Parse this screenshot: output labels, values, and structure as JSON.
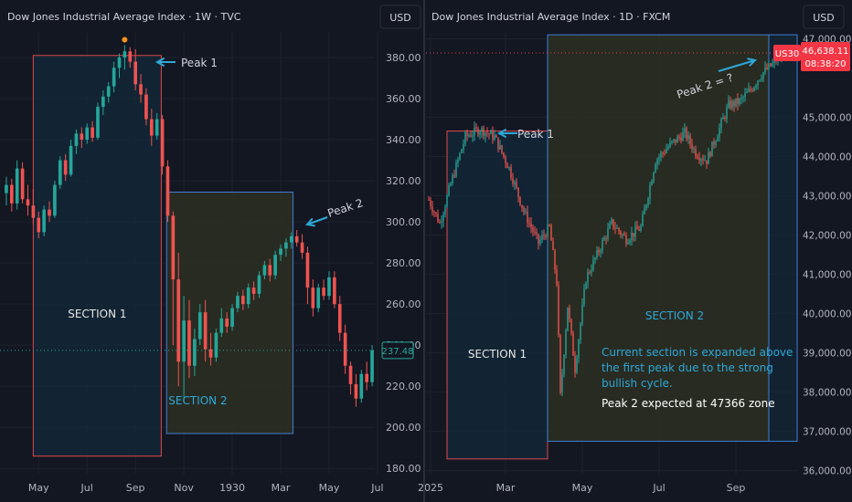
{
  "colors": {
    "background": "#131722",
    "grid": "#1e222d",
    "up": "#26a69a",
    "down": "#ef5350",
    "axis_text": "#b2b5be",
    "title_text": "#d1d4dc",
    "section1_fill": "#132a3a",
    "section1_border": "#e0464b",
    "section2_fill": "#2d2f22",
    "section2_border": "#3f7fd4",
    "arrow": "#2ea8d8",
    "section2_label": "#2ea8d8",
    "note_text": "#2ea8d8",
    "price_tag": "#26a69a",
    "us30_tag": "#f23645",
    "dot": "#f7931a"
  },
  "chart_data": [
    {
      "type": "candlestick",
      "title": "Dow Jones Industrial Average Index · 1W · TVC",
      "currency_button": "USD",
      "y_ticks": [
        "380.00",
        "360.00",
        "340.00",
        "320.00",
        "300.00",
        "280.00",
        "260.00",
        "240.00",
        "220.00",
        "200.00",
        "180.00"
      ],
      "y_values": [
        380,
        360,
        340,
        320,
        300,
        280,
        260,
        240,
        220,
        200,
        180
      ],
      "ylim": [
        177,
        392
      ],
      "x_ticks": [
        "May",
        "Jul",
        "Sep",
        "Nov",
        "1930",
        "Mar",
        "May",
        "Jul"
      ],
      "x_tick_index": [
        6,
        15,
        24,
        33,
        42,
        51,
        60,
        69
      ],
      "last_price": "237.48",
      "candles": [
        {
          "o": 314,
          "h": 322,
          "l": 308,
          "c": 318
        },
        {
          "o": 318,
          "h": 321,
          "l": 305,
          "c": 309
        },
        {
          "o": 309,
          "h": 330,
          "l": 306,
          "c": 326
        },
        {
          "o": 326,
          "h": 329,
          "l": 309,
          "c": 311
        },
        {
          "o": 311,
          "h": 318,
          "l": 303,
          "c": 308
        },
        {
          "o": 308,
          "h": 316,
          "l": 299,
          "c": 302
        },
        {
          "o": 302,
          "h": 305,
          "l": 292,
          "c": 295
        },
        {
          "o": 295,
          "h": 308,
          "l": 293,
          "c": 306
        },
        {
          "o": 306,
          "h": 310,
          "l": 300,
          "c": 303
        },
        {
          "o": 303,
          "h": 320,
          "l": 302,
          "c": 318
        },
        {
          "o": 318,
          "h": 332,
          "l": 316,
          "c": 330
        },
        {
          "o": 330,
          "h": 333,
          "l": 320,
          "c": 323
        },
        {
          "o": 323,
          "h": 340,
          "l": 322,
          "c": 337
        },
        {
          "o": 337,
          "h": 345,
          "l": 333,
          "c": 343
        },
        {
          "o": 343,
          "h": 346,
          "l": 336,
          "c": 340
        },
        {
          "o": 340,
          "h": 348,
          "l": 338,
          "c": 346
        },
        {
          "o": 346,
          "h": 349,
          "l": 339,
          "c": 341
        },
        {
          "o": 341,
          "h": 358,
          "l": 340,
          "c": 356
        },
        {
          "o": 356,
          "h": 364,
          "l": 352,
          "c": 361
        },
        {
          "o": 361,
          "h": 368,
          "l": 358,
          "c": 366
        },
        {
          "o": 366,
          "h": 378,
          "l": 363,
          "c": 375
        },
        {
          "o": 375,
          "h": 382,
          "l": 370,
          "c": 380
        },
        {
          "o": 380,
          "h": 386,
          "l": 374,
          "c": 383
        },
        {
          "o": 383,
          "h": 385,
          "l": 375,
          "c": 378
        },
        {
          "o": 378,
          "h": 384,
          "l": 364,
          "c": 367
        },
        {
          "o": 367,
          "h": 372,
          "l": 358,
          "c": 362
        },
        {
          "o": 362,
          "h": 365,
          "l": 347,
          "c": 350
        },
        {
          "o": 350,
          "h": 355,
          "l": 337,
          "c": 342
        },
        {
          "o": 342,
          "h": 353,
          "l": 340,
          "c": 350
        },
        {
          "o": 350,
          "h": 352,
          "l": 323,
          "c": 327
        },
        {
          "o": 327,
          "h": 330,
          "l": 300,
          "c": 303
        },
        {
          "o": 303,
          "h": 305,
          "l": 240,
          "c": 272
        },
        {
          "o": 272,
          "h": 285,
          "l": 220,
          "c": 232
        },
        {
          "o": 232,
          "h": 264,
          "l": 212,
          "c": 252
        },
        {
          "o": 252,
          "h": 262,
          "l": 224,
          "c": 230
        },
        {
          "o": 230,
          "h": 248,
          "l": 225,
          "c": 243
        },
        {
          "o": 243,
          "h": 260,
          "l": 240,
          "c": 256
        },
        {
          "o": 256,
          "h": 262,
          "l": 232,
          "c": 238
        },
        {
          "o": 238,
          "h": 246,
          "l": 230,
          "c": 234
        },
        {
          "o": 234,
          "h": 248,
          "l": 232,
          "c": 246
        },
        {
          "o": 246,
          "h": 258,
          "l": 244,
          "c": 253
        },
        {
          "o": 253,
          "h": 256,
          "l": 246,
          "c": 249
        },
        {
          "o": 249,
          "h": 260,
          "l": 247,
          "c": 258
        },
        {
          "o": 258,
          "h": 266,
          "l": 256,
          "c": 264
        },
        {
          "o": 264,
          "h": 267,
          "l": 257,
          "c": 260
        },
        {
          "o": 260,
          "h": 270,
          "l": 258,
          "c": 268
        },
        {
          "o": 268,
          "h": 271,
          "l": 262,
          "c": 265
        },
        {
          "o": 265,
          "h": 276,
          "l": 263,
          "c": 274
        },
        {
          "o": 274,
          "h": 281,
          "l": 272,
          "c": 279
        },
        {
          "o": 279,
          "h": 282,
          "l": 271,
          "c": 274
        },
        {
          "o": 274,
          "h": 286,
          "l": 272,
          "c": 284
        },
        {
          "o": 284,
          "h": 289,
          "l": 281,
          "c": 287
        },
        {
          "o": 287,
          "h": 292,
          "l": 283,
          "c": 290
        },
        {
          "o": 290,
          "h": 295,
          "l": 287,
          "c": 293
        },
        {
          "o": 293,
          "h": 296,
          "l": 288,
          "c": 290
        },
        {
          "o": 290,
          "h": 294,
          "l": 282,
          "c": 285
        },
        {
          "o": 285,
          "h": 288,
          "l": 260,
          "c": 268
        },
        {
          "o": 268,
          "h": 272,
          "l": 254,
          "c": 258
        },
        {
          "o": 258,
          "h": 270,
          "l": 256,
          "c": 268
        },
        {
          "o": 268,
          "h": 272,
          "l": 262,
          "c": 264
        },
        {
          "o": 264,
          "h": 276,
          "l": 262,
          "c": 273
        },
        {
          "o": 273,
          "h": 276,
          "l": 258,
          "c": 260
        },
        {
          "o": 260,
          "h": 264,
          "l": 242,
          "c": 246
        },
        {
          "o": 246,
          "h": 250,
          "l": 226,
          "c": 230
        },
        {
          "o": 230,
          "h": 232,
          "l": 216,
          "c": 221
        },
        {
          "o": 221,
          "h": 226,
          "l": 210,
          "c": 214
        },
        {
          "o": 214,
          "h": 228,
          "l": 212,
          "c": 226
        },
        {
          "o": 226,
          "h": 232,
          "l": 218,
          "c": 222
        },
        {
          "o": 222,
          "h": 240,
          "l": 220,
          "c": 237.48
        }
      ],
      "annotations": [
        {
          "text": "Peak 1"
        },
        {
          "text": "Peak 2"
        },
        {
          "text": "SECTION 1"
        },
        {
          "text": "SECTION 2"
        }
      ]
    },
    {
      "type": "candlestick",
      "title": "Dow Jones Industrial Average Index · 1D · FXCM",
      "currency_button": "USD",
      "y_ticks": [
        "47,000.00",
        "45,000.00",
        "44,000.00",
        "43,000.00",
        "42,000.00",
        "41,000.00",
        "40,000.00",
        "39,000.00",
        "38,000.00",
        "37,000.00",
        "36,000.00"
      ],
      "y_values": [
        47000,
        45000,
        44000,
        43000,
        42000,
        41000,
        40000,
        39000,
        38000,
        37000,
        36000
      ],
      "ylim": [
        35900,
        47150
      ],
      "x_ticks": [
        "2025",
        "Mar",
        "May",
        "Jul",
        "Sep"
      ],
      "x_tick_index": [
        1,
        42,
        84,
        126,
        168
      ],
      "last_price": "46,638.11",
      "symbol_tag": "US30",
      "countdown": "08:38:20",
      "series_knots": [
        {
          "i": 0,
          "v": 42900
        },
        {
          "i": 6,
          "v": 42300
        },
        {
          "i": 12,
          "v": 43300
        },
        {
          "i": 20,
          "v": 44500
        },
        {
          "i": 28,
          "v": 44700
        },
        {
          "i": 36,
          "v": 44500
        },
        {
          "i": 44,
          "v": 43700
        },
        {
          "i": 52,
          "v": 42600
        },
        {
          "i": 60,
          "v": 41800
        },
        {
          "i": 66,
          "v": 42200
        },
        {
          "i": 70,
          "v": 40800
        },
        {
          "i": 72,
          "v": 37900
        },
        {
          "i": 76,
          "v": 40200
        },
        {
          "i": 80,
          "v": 38600
        },
        {
          "i": 86,
          "v": 40900
        },
        {
          "i": 94,
          "v": 41700
        },
        {
          "i": 100,
          "v": 42300
        },
        {
          "i": 108,
          "v": 41900
        },
        {
          "i": 116,
          "v": 42200
        },
        {
          "i": 124,
          "v": 43900
        },
        {
          "i": 132,
          "v": 44300
        },
        {
          "i": 140,
          "v": 44600
        },
        {
          "i": 146,
          "v": 44100
        },
        {
          "i": 152,
          "v": 43900
        },
        {
          "i": 158,
          "v": 44600
        },
        {
          "i": 164,
          "v": 45300
        },
        {
          "i": 170,
          "v": 45400
        },
        {
          "i": 176,
          "v": 45700
        },
        {
          "i": 182,
          "v": 46100
        },
        {
          "i": 188,
          "v": 46350
        },
        {
          "i": 193,
          "v": 46638.11
        }
      ],
      "annotations": [
        {
          "text": "Peak 1"
        },
        {
          "text": "Peak 2 = ?"
        },
        {
          "text": "SECTION 1"
        },
        {
          "text": "SECTION 2"
        },
        {
          "text": "Current section is expanded above"
        },
        {
          "text": "the first peak due to the strong"
        },
        {
          "text": "bullish cycle."
        },
        {
          "text": "Peak 2 expected at 47366 zone"
        }
      ]
    }
  ]
}
